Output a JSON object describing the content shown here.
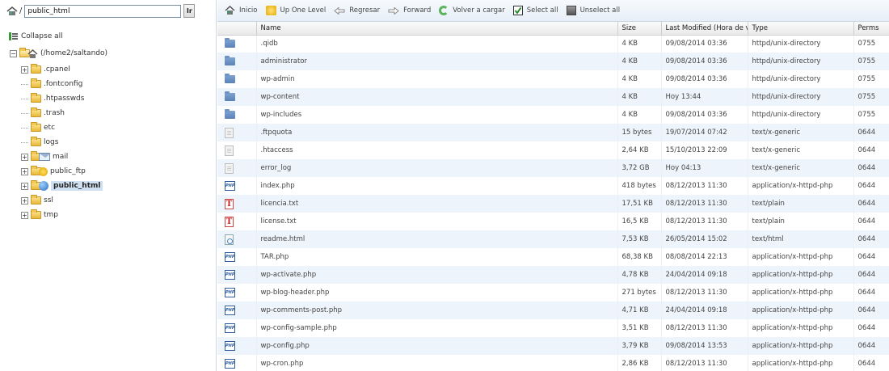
{
  "path_bar": {
    "prefix": "/",
    "path": "public_html",
    "go_label": "Ir"
  },
  "tree": {
    "collapse_label": "Collapse all",
    "root_label": "(/home2/saltando)",
    "items": [
      {
        "label": ".cpanel",
        "expandable": true
      },
      {
        "label": ".fontconfig",
        "expandable": false
      },
      {
        "label": ".htpasswds",
        "expandable": false
      },
      {
        "label": ".trash",
        "expandable": false
      },
      {
        "label": "etc",
        "expandable": false
      },
      {
        "label": "logs",
        "expandable": false
      },
      {
        "label": "mail",
        "expandable": true,
        "badge": "mail-icon"
      },
      {
        "label": "public_ftp",
        "expandable": true,
        "badge": "ftp-icon"
      },
      {
        "label": "public_html",
        "expandable": true,
        "badge": "web-globe-icon",
        "selected": true
      },
      {
        "label": "ssl",
        "expandable": true
      },
      {
        "label": "tmp",
        "expandable": true
      }
    ]
  },
  "toolbar": {
    "home": "Inicio",
    "up": "Up One Level",
    "back": "Regresar",
    "forward": "Forward",
    "reload": "Volver a cargar",
    "select_all": "Select all",
    "unselect_all": "Unselect all"
  },
  "table": {
    "columns": [
      "Name",
      "Size",
      "Last Modified (Hora de ve",
      "Type",
      "Perms"
    ],
    "rows": [
      {
        "icon": "folder-icon",
        "name": ".qidb",
        "size": "4 KB",
        "modified": "09/08/2014 03:36",
        "type": "httpd/unix-directory",
        "perms": "0755"
      },
      {
        "icon": "folder-icon",
        "name": "administrator",
        "size": "4 KB",
        "modified": "09/08/2014 03:36",
        "type": "httpd/unix-directory",
        "perms": "0755"
      },
      {
        "icon": "folder-icon",
        "name": "wp-admin",
        "size": "4 KB",
        "modified": "09/08/2014 03:36",
        "type": "httpd/unix-directory",
        "perms": "0755"
      },
      {
        "icon": "folder-icon",
        "name": "wp-content",
        "size": "4 KB",
        "modified": "Hoy 13:44",
        "type": "httpd/unix-directory",
        "perms": "0755"
      },
      {
        "icon": "folder-icon",
        "name": "wp-includes",
        "size": "4 KB",
        "modified": "09/08/2014 03:36",
        "type": "httpd/unix-directory",
        "perms": "0755"
      },
      {
        "icon": "generic-file-icon",
        "name": ".ftpquota",
        "size": "15 bytes",
        "modified": "19/07/2014 07:42",
        "type": "text/x-generic",
        "perms": "0644"
      },
      {
        "icon": "generic-file-icon",
        "name": ".htaccess",
        "size": "2,64 KB",
        "modified": "15/10/2013 22:09",
        "type": "text/x-generic",
        "perms": "0644"
      },
      {
        "icon": "generic-file-icon",
        "name": "error_log",
        "size": "3,72 GB",
        "modified": "Hoy 04:13",
        "type": "text/x-generic",
        "perms": "0644"
      },
      {
        "icon": "php-file-icon",
        "name": "index.php",
        "size": "418 bytes",
        "modified": "08/12/2013 11:30",
        "type": "application/x-httpd-php",
        "perms": "0644"
      },
      {
        "icon": "text-file-icon",
        "name": "licencia.txt",
        "size": "17,51 KB",
        "modified": "08/12/2013 11:30",
        "type": "text/plain",
        "perms": "0644"
      },
      {
        "icon": "text-file-icon",
        "name": "license.txt",
        "size": "16,5 KB",
        "modified": "08/12/2013 11:30",
        "type": "text/plain",
        "perms": "0644"
      },
      {
        "icon": "html-file-icon",
        "name": "readme.html",
        "size": "7,53 KB",
        "modified": "26/05/2014 15:02",
        "type": "text/html",
        "perms": "0644"
      },
      {
        "icon": "php-file-icon",
        "name": "TAR.php",
        "size": "68,38 KB",
        "modified": "08/08/2014 22:13",
        "type": "application/x-httpd-php",
        "perms": "0644"
      },
      {
        "icon": "php-file-icon",
        "name": "wp-activate.php",
        "size": "4,78 KB",
        "modified": "24/04/2014 09:18",
        "type": "application/x-httpd-php",
        "perms": "0644"
      },
      {
        "icon": "php-file-icon",
        "name": "wp-blog-header.php",
        "size": "271 bytes",
        "modified": "08/12/2013 11:30",
        "type": "application/x-httpd-php",
        "perms": "0644"
      },
      {
        "icon": "php-file-icon",
        "name": "wp-comments-post.php",
        "size": "4,71 KB",
        "modified": "24/04/2014 09:18",
        "type": "application/x-httpd-php",
        "perms": "0644"
      },
      {
        "icon": "php-file-icon",
        "name": "wp-config-sample.php",
        "size": "3,51 KB",
        "modified": "08/12/2013 11:30",
        "type": "application/x-httpd-php",
        "perms": "0644"
      },
      {
        "icon": "php-file-icon",
        "name": "wp-config.php",
        "size": "3,79 KB",
        "modified": "09/08/2014 13:53",
        "type": "application/x-httpd-php",
        "perms": "0644"
      },
      {
        "icon": "php-file-icon",
        "name": "wp-cron.php",
        "size": "2,86 KB",
        "modified": "08/12/2013 11:30",
        "type": "application/x-httpd-php",
        "perms": "0644"
      }
    ]
  },
  "icon_labels": {
    "php": "PHP",
    "txt": "T"
  },
  "colors": {
    "selected_row": "#cfe0f1",
    "odd_row": "#eef4fb",
    "toolbar_bg": "#e6eef7",
    "folder_blue": "#5a82b8"
  }
}
